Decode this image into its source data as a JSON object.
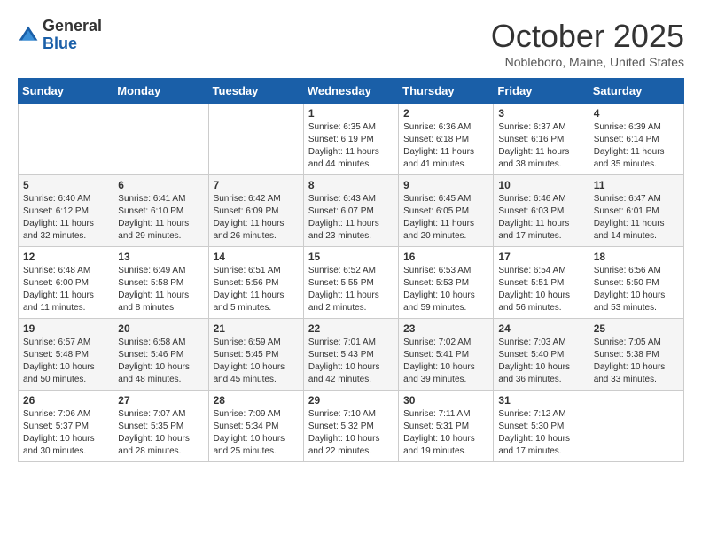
{
  "header": {
    "logo_general": "General",
    "logo_blue": "Blue",
    "month_title": "October 2025",
    "location": "Nobleboro, Maine, United States"
  },
  "weekdays": [
    "Sunday",
    "Monday",
    "Tuesday",
    "Wednesday",
    "Thursday",
    "Friday",
    "Saturday"
  ],
  "weeks": [
    [
      {
        "day": "",
        "info": ""
      },
      {
        "day": "",
        "info": ""
      },
      {
        "day": "",
        "info": ""
      },
      {
        "day": "1",
        "info": "Sunrise: 6:35 AM\nSunset: 6:19 PM\nDaylight: 11 hours\nand 44 minutes."
      },
      {
        "day": "2",
        "info": "Sunrise: 6:36 AM\nSunset: 6:18 PM\nDaylight: 11 hours\nand 41 minutes."
      },
      {
        "day": "3",
        "info": "Sunrise: 6:37 AM\nSunset: 6:16 PM\nDaylight: 11 hours\nand 38 minutes."
      },
      {
        "day": "4",
        "info": "Sunrise: 6:39 AM\nSunset: 6:14 PM\nDaylight: 11 hours\nand 35 minutes."
      }
    ],
    [
      {
        "day": "5",
        "info": "Sunrise: 6:40 AM\nSunset: 6:12 PM\nDaylight: 11 hours\nand 32 minutes."
      },
      {
        "day": "6",
        "info": "Sunrise: 6:41 AM\nSunset: 6:10 PM\nDaylight: 11 hours\nand 29 minutes."
      },
      {
        "day": "7",
        "info": "Sunrise: 6:42 AM\nSunset: 6:09 PM\nDaylight: 11 hours\nand 26 minutes."
      },
      {
        "day": "8",
        "info": "Sunrise: 6:43 AM\nSunset: 6:07 PM\nDaylight: 11 hours\nand 23 minutes."
      },
      {
        "day": "9",
        "info": "Sunrise: 6:45 AM\nSunset: 6:05 PM\nDaylight: 11 hours\nand 20 minutes."
      },
      {
        "day": "10",
        "info": "Sunrise: 6:46 AM\nSunset: 6:03 PM\nDaylight: 11 hours\nand 17 minutes."
      },
      {
        "day": "11",
        "info": "Sunrise: 6:47 AM\nSunset: 6:01 PM\nDaylight: 11 hours\nand 14 minutes."
      }
    ],
    [
      {
        "day": "12",
        "info": "Sunrise: 6:48 AM\nSunset: 6:00 PM\nDaylight: 11 hours\nand 11 minutes."
      },
      {
        "day": "13",
        "info": "Sunrise: 6:49 AM\nSunset: 5:58 PM\nDaylight: 11 hours\nand 8 minutes."
      },
      {
        "day": "14",
        "info": "Sunrise: 6:51 AM\nSunset: 5:56 PM\nDaylight: 11 hours\nand 5 minutes."
      },
      {
        "day": "15",
        "info": "Sunrise: 6:52 AM\nSunset: 5:55 PM\nDaylight: 11 hours\nand 2 minutes."
      },
      {
        "day": "16",
        "info": "Sunrise: 6:53 AM\nSunset: 5:53 PM\nDaylight: 10 hours\nand 59 minutes."
      },
      {
        "day": "17",
        "info": "Sunrise: 6:54 AM\nSunset: 5:51 PM\nDaylight: 10 hours\nand 56 minutes."
      },
      {
        "day": "18",
        "info": "Sunrise: 6:56 AM\nSunset: 5:50 PM\nDaylight: 10 hours\nand 53 minutes."
      }
    ],
    [
      {
        "day": "19",
        "info": "Sunrise: 6:57 AM\nSunset: 5:48 PM\nDaylight: 10 hours\nand 50 minutes."
      },
      {
        "day": "20",
        "info": "Sunrise: 6:58 AM\nSunset: 5:46 PM\nDaylight: 10 hours\nand 48 minutes."
      },
      {
        "day": "21",
        "info": "Sunrise: 6:59 AM\nSunset: 5:45 PM\nDaylight: 10 hours\nand 45 minutes."
      },
      {
        "day": "22",
        "info": "Sunrise: 7:01 AM\nSunset: 5:43 PM\nDaylight: 10 hours\nand 42 minutes."
      },
      {
        "day": "23",
        "info": "Sunrise: 7:02 AM\nSunset: 5:41 PM\nDaylight: 10 hours\nand 39 minutes."
      },
      {
        "day": "24",
        "info": "Sunrise: 7:03 AM\nSunset: 5:40 PM\nDaylight: 10 hours\nand 36 minutes."
      },
      {
        "day": "25",
        "info": "Sunrise: 7:05 AM\nSunset: 5:38 PM\nDaylight: 10 hours\nand 33 minutes."
      }
    ],
    [
      {
        "day": "26",
        "info": "Sunrise: 7:06 AM\nSunset: 5:37 PM\nDaylight: 10 hours\nand 30 minutes."
      },
      {
        "day": "27",
        "info": "Sunrise: 7:07 AM\nSunset: 5:35 PM\nDaylight: 10 hours\nand 28 minutes."
      },
      {
        "day": "28",
        "info": "Sunrise: 7:09 AM\nSunset: 5:34 PM\nDaylight: 10 hours\nand 25 minutes."
      },
      {
        "day": "29",
        "info": "Sunrise: 7:10 AM\nSunset: 5:32 PM\nDaylight: 10 hours\nand 22 minutes."
      },
      {
        "day": "30",
        "info": "Sunrise: 7:11 AM\nSunset: 5:31 PM\nDaylight: 10 hours\nand 19 minutes."
      },
      {
        "day": "31",
        "info": "Sunrise: 7:12 AM\nSunset: 5:30 PM\nDaylight: 10 hours\nand 17 minutes."
      },
      {
        "day": "",
        "info": ""
      }
    ]
  ]
}
